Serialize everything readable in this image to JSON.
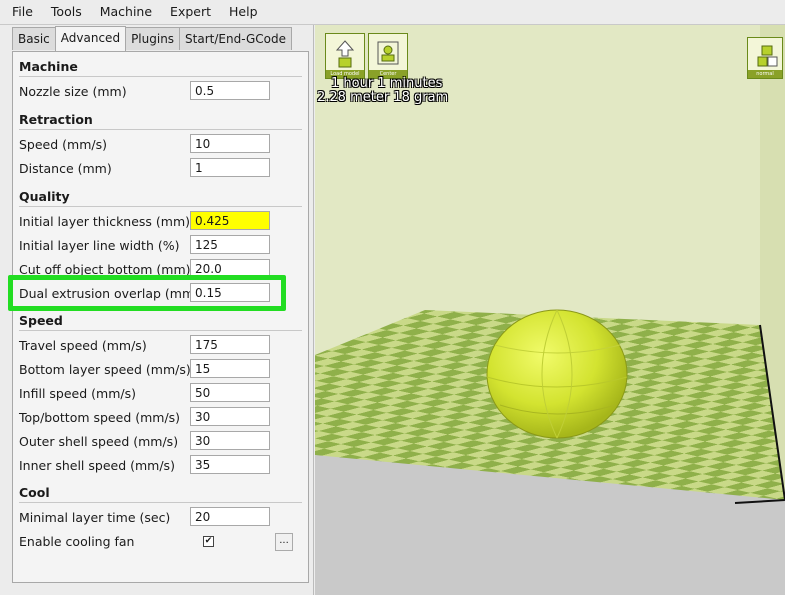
{
  "menu": {
    "items": [
      "File",
      "Tools",
      "Machine",
      "Expert",
      "Help"
    ]
  },
  "tabs": [
    {
      "label": "Basic"
    },
    {
      "label": "Advanced"
    },
    {
      "label": "Plugins"
    },
    {
      "label": "Start/End-GCode"
    }
  ],
  "settings": {
    "machine": {
      "title": "Machine",
      "nozzle_label": "Nozzle size (mm)",
      "nozzle_value": "0.5"
    },
    "retraction": {
      "title": "Retraction",
      "speed_label": "Speed (mm/s)",
      "speed_value": "10",
      "distance_label": "Distance (mm)",
      "distance_value": "1"
    },
    "quality": {
      "title": "Quality",
      "layer_thickness_label": "Initial layer thickness (mm)",
      "layer_thickness_value": "0.425",
      "line_width_label": "Initial layer line width (%)",
      "line_width_value": "125",
      "cut_off_label": "Cut off object bottom (mm)",
      "cut_off_value": "20.0",
      "dual_overlap_label": "Dual extrusion overlap (mm)",
      "dual_overlap_value": "0.15"
    },
    "speed": {
      "title": "Speed",
      "travel_label": "Travel speed (mm/s)",
      "travel_value": "175",
      "bottom_label": "Bottom layer speed (mm/s)",
      "bottom_value": "15",
      "infill_label": "Infill speed (mm/s)",
      "infill_value": "50",
      "topbottom_label": "Top/bottom speed (mm/s)",
      "topbottom_value": "30",
      "outer_label": "Outer shell speed (mm/s)",
      "outer_value": "30",
      "inner_label": "Inner shell speed (mm/s)",
      "inner_value": "35"
    },
    "cool": {
      "title": "Cool",
      "layer_time_label": "Minimal layer time (sec)",
      "layer_time_value": "20",
      "fan_label": "Enable cooling fan",
      "fan_checked": "✔",
      "fan_more": "..."
    }
  },
  "viewport": {
    "print_time": "1 hour 1 minutes",
    "print_material": "2.28 meter 18 gram",
    "buttons": [
      {
        "caption": "Load model",
        "icon": "load-model-icon"
      },
      {
        "caption": "Center",
        "icon": "center-icon"
      },
      {
        "caption": "normal",
        "icon": "view-mode-icon"
      }
    ],
    "colors": {
      "model": "#e4f23c",
      "wall": "#e2e8c4",
      "platform_light": "#c9d988",
      "platform_dark": "#8fb04a",
      "highlight": "#22dd22",
      "field_highlight": "#ffff00"
    }
  }
}
